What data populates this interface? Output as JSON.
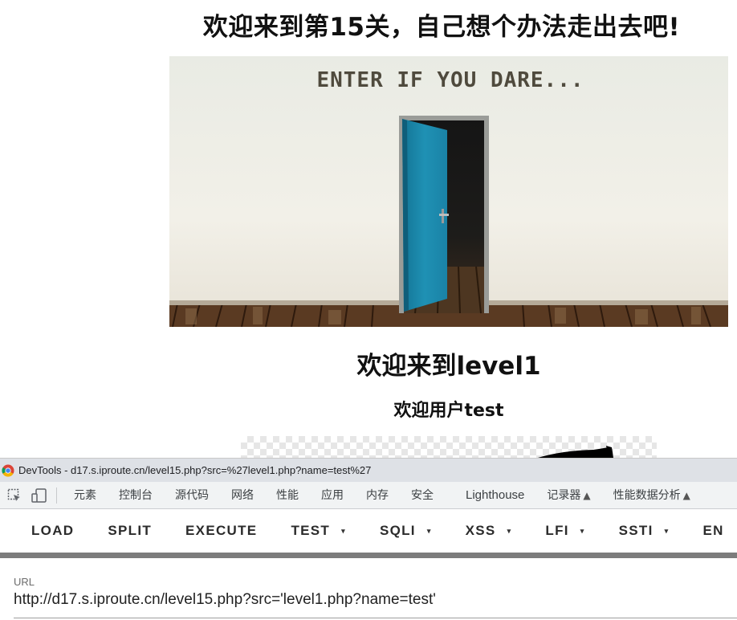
{
  "page": {
    "heading": "欢迎来到第15关，自己想个办法走出去吧!",
    "banner_text": "ENTER IF YOU DARE...",
    "level_heading": "欢迎来到level1",
    "user_greeting": "欢迎用户test"
  },
  "devtools": {
    "title": "DevTools - d17.s.iproute.cn/level15.php?src=%27level1.php?name=test%27",
    "tabs": [
      "元素",
      "控制台",
      "源代码",
      "网络",
      "性能",
      "应用",
      "内存",
      "安全",
      "Lighthouse",
      "记录器",
      "性能数据分析"
    ],
    "icons": [
      "inspect-element-icon",
      "device-toolbar-icon",
      "flask-icon"
    ]
  },
  "toolbar": {
    "load": "LOAD",
    "split": "SPLIT",
    "execute": "EXECUTE",
    "test": "TEST",
    "sqli": "SQLI",
    "xss": "XSS",
    "lfi": "LFI",
    "ssti": "SSTI",
    "encode": "EN",
    "caret": "▾"
  },
  "url": {
    "label": "URL",
    "value": "http://d17.s.iproute.cn/level15.php?src='level1.php?name=test'"
  },
  "colors": {
    "door": "#1e8cae",
    "wall": "#ebece4",
    "devtools_bg": "#f1f3f4",
    "grey_bar": "#7c7c7c"
  }
}
